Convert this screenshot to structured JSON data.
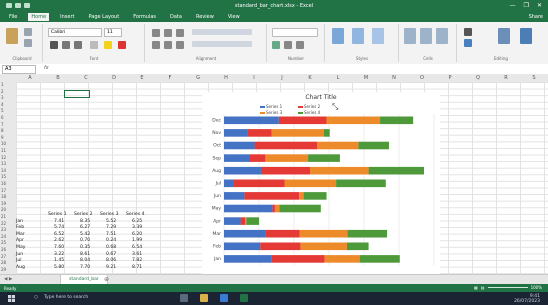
{
  "window": {
    "title": "standard_bar_chart.xlsx - Excel",
    "controls": [
      "—",
      "❐",
      "✕"
    ]
  },
  "tabs": [
    "File",
    "Home",
    "Insert",
    "Page Layout",
    "Formulas",
    "Data",
    "Review",
    "View"
  ],
  "tabs_right": "Share",
  "ribbon": {
    "groups": [
      "Clipboard",
      "Font",
      "Alignment",
      "Number",
      "Styles",
      "Cells",
      "Editing"
    ],
    "font_name": "Calibri",
    "font_size": "11"
  },
  "formula_bar": {
    "name_box": "A3",
    "fx": "fx",
    "value": ""
  },
  "columns": [
    "A",
    "B",
    "C",
    "D",
    "E",
    "F",
    "G",
    "H",
    "I",
    "J",
    "K",
    "L",
    "M",
    "N",
    "O",
    "P",
    "Q",
    "R",
    "S"
  ],
  "rows": [
    "1",
    "2",
    "3",
    "4",
    "5",
    "6",
    "7",
    "8",
    "9",
    "10",
    "11",
    "12",
    "13",
    "14",
    "15",
    "16",
    "17",
    "18",
    "19",
    "20",
    "21",
    "22",
    "23",
    "24",
    "25",
    "26",
    "27",
    "28",
    "29"
  ],
  "table": {
    "headers": [
      "Series 1",
      "Series 2",
      "Series 3",
      "Series 4"
    ],
    "rows": [
      {
        "row": "18",
        "month": "Jan",
        "v": [
          "7.41",
          "8.35",
          "5.52",
          "6.25"
        ]
      },
      {
        "row": "19",
        "month": "Feb",
        "v": [
          "5.74",
          "6.27",
          "7.29",
          "3.39"
        ]
      },
      {
        "row": "20",
        "month": "Mar",
        "v": [
          "6.52",
          "5.42",
          "7.51",
          "6.20"
        ]
      },
      {
        "row": "21",
        "month": "Apr",
        "v": [
          "2.62",
          "0.70",
          "0.24",
          "1.99"
        ]
      },
      {
        "row": "22",
        "month": "May",
        "v": [
          "7.60",
          "0.35",
          "0.68",
          "6.54"
        ]
      },
      {
        "row": "23",
        "month": "Jun",
        "v": [
          "3.22",
          "8.61",
          "0.67",
          "3.61"
        ]
      },
      {
        "row": "24",
        "month": "Jul",
        "v": [
          "1.45",
          "8.04",
          "8.06",
          "7.82"
        ]
      },
      {
        "row": "25",
        "month": "Aug",
        "v": [
          "5.80",
          "7.70",
          "9.21",
          "8.71"
        ]
      }
    ]
  },
  "chart_data": {
    "type": "bar",
    "orientation": "horizontal",
    "stacked": true,
    "title": "Chart Title",
    "categories": [
      "Jan",
      "Feb",
      "Mar",
      "Apr",
      "May",
      "Jun",
      "Jul",
      "Aug",
      "Sep",
      "Oct",
      "Nov",
      "Dec"
    ],
    "series": [
      {
        "name": "Series 1",
        "color": "#4472c4",
        "values": [
          7.4,
          5.7,
          6.5,
          2.6,
          7.6,
          3.2,
          1.5,
          5.8,
          4.0,
          4.8,
          3.7,
          8.6
        ]
      },
      {
        "name": "Series 2",
        "color": "#e53935",
        "values": [
          8.4,
          6.3,
          5.4,
          0.7,
          0.4,
          8.6,
          8.0,
          7.7,
          2.5,
          9.8,
          3.8,
          7.5
        ]
      },
      {
        "name": "Series 3",
        "color": "#ed8b2b",
        "values": [
          5.5,
          7.3,
          7.5,
          0.2,
          0.7,
          0.7,
          8.1,
          9.2,
          6.7,
          6.5,
          8.2,
          8.4
        ]
      },
      {
        "name": "Series 4",
        "color": "#4e9a3b",
        "values": [
          6.3,
          3.4,
          6.2,
          2.0,
          6.5,
          3.6,
          7.8,
          8.7,
          5.0,
          4.8,
          0.9,
          5.2
        ]
      }
    ],
    "legend": "top",
    "grid": true
  },
  "sheet_tab": "standard_bar",
  "status": {
    "ready": "Ready",
    "zoom": "100%"
  },
  "taskbar": {
    "search": "Type here to search",
    "time": "9:41",
    "date": "26/07/2023"
  },
  "colors": {
    "excel_green": "#217346",
    "taskbar": "#1a2433"
  }
}
